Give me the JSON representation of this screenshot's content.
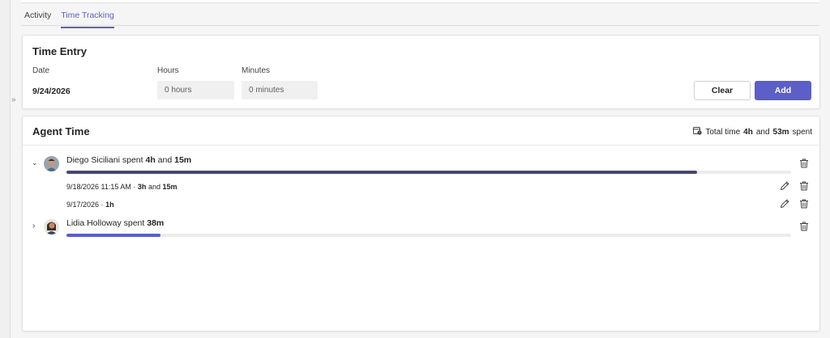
{
  "tabs": [
    {
      "label": "Activity",
      "active": false
    },
    {
      "label": "Time Tracking",
      "active": true
    }
  ],
  "time_entry": {
    "title": "Time Entry",
    "date_label": "Date",
    "hours_label": "Hours",
    "minutes_label": "Minutes",
    "date_value": "9/24/2026",
    "hours_placeholder": "0 hours",
    "minutes_placeholder": "0 minutes",
    "clear_label": "Clear",
    "add_label": "Add"
  },
  "agent_time": {
    "title": "Agent Time",
    "total_prefix": "Total time",
    "total_hours": "4h",
    "total_and": "and",
    "total_minutes": "53m",
    "total_suffix": "spent",
    "agents": [
      {
        "name_text": "Diego Siciliani spent",
        "hours": "4h",
        "and": "and",
        "minutes": "15m",
        "progress": 0.87,
        "expanded": true,
        "entries": [
          {
            "timestamp": "9/18/2026 11:15 AM ·",
            "hours": "3h",
            "and": "and",
            "minutes": "15m"
          },
          {
            "timestamp": "9/17/2026 ·",
            "hours": "1h"
          }
        ]
      },
      {
        "name_text": "Lidia Holloway spent",
        "minutes": "38m",
        "progress": 0.13,
        "expanded": false
      }
    ]
  },
  "colors": {
    "accent": "#5b5fc7",
    "bar_dark": "#464775",
    "bar_light": "#5b5fc7"
  },
  "icons": {
    "expand_panel": "double-chevron-right-icon",
    "total": "calendar-clock-icon",
    "delete": "trash-icon",
    "edit": "pencil-icon"
  }
}
